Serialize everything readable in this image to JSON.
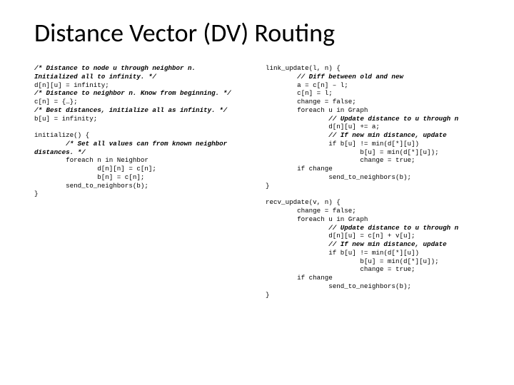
{
  "title": "Distance Vector (DV) Routing",
  "left": {
    "c1": "/* Distance to node u through neighbor n.\nInitialized all to infinity. */",
    "l1": "d[n][u] = infinity;",
    "c2": "/* Distance to neighbor n. Know from beginning. */",
    "l2": "c[n] = {…};",
    "c3": "/* Best distances, initialize all as infinity. */",
    "l3": "b[u] = infinity;\n",
    "l4": "initialize() {",
    "c4": "        /* Set all values can from known neighbor\ndistances. */",
    "l5": "        foreach n in Neighbor\n                d[n][n] = c[n];\n                b[n] = c[n];\n        send_to_neighbors(b);\n}"
  },
  "right": {
    "b1": "link_update(l, n) {",
    "c1": "        // Diff between old and new",
    "l1": "        a = c[n] – l;\n        c[n] = l;\n        change = false;\n        foreach u in Graph",
    "c2": "                // Update distance to u through n",
    "l2": "                d[n][u] += a;",
    "c3": "                // If new min distance, update",
    "l3": "                if b[u] != min(d[*][u])\n                        b[u] = min(d[*][u]);\n                        change = true;\n        if change\n                send_to_neighbors(b);\n}\n",
    "b2": "recv_update(v, n) {\n        change = false;\n        foreach u in Graph",
    "c4": "                // Update distance to u through n",
    "l4": "                d[n][u] = c[n] + v[u];",
    "c5": "                // If new min distance, update",
    "l5": "                if b[u] != min(d[*][u])\n                        b[u] = min(d[*][u]);\n                        change = true;\n        if change\n                send_to_neighbors(b);\n}"
  }
}
